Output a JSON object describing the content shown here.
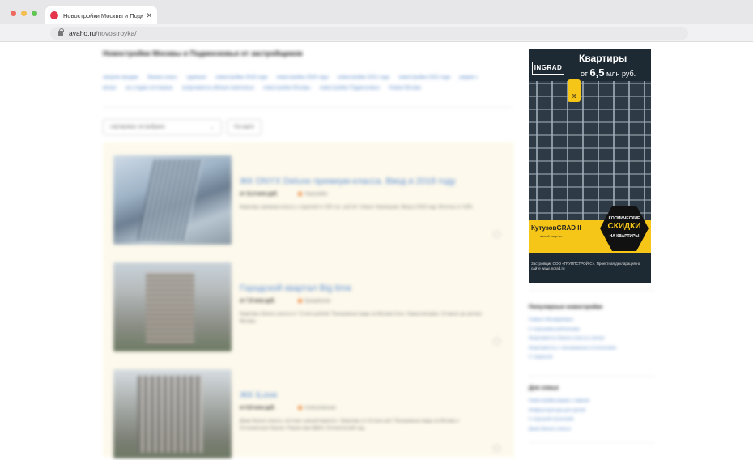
{
  "browser": {
    "tab_title": "Новостройки Москвы и Подм",
    "tab_close": "✕",
    "url_host": "avaho.ru",
    "url_path": "/novostroyka/"
  },
  "page": {
    "title": "Новостройки Москвы и Подмосковья от застройщиков",
    "tags": [
      "запуски продаж",
      "бизнес-класс",
      "сданные",
      "новостройки 2018 года",
      "новостройки 2020 года",
      "новостройки 2021 года",
      "новостройки 2022 года",
      "рядом с метро",
      "на стадии котлована",
      "апартаменты вблизи комплекса",
      "новостройки Москвы",
      "новостройки Подмосковья",
      "Новая Москва"
    ],
    "sort_label": "сортировка: не выбрано",
    "sort_chevron": "⌄",
    "map_button": "На карте"
  },
  "listings": [
    {
      "title": "ЖК ONYX Deluxe премиум-класса. Ввод в 2018 году",
      "price": "от 11,4 млн руб.",
      "metro": "Хорошёво",
      "desc": "Квартиры премиум-класса с отделкой от 230 тыс. руб./м². Новые Черемушки. Ввод в 2018 году. Ипотека от 4,8%."
    },
    {
      "title": "Городской квартал Big time",
      "price": "от 7,9 млн руб.",
      "metro": "Кунцевская",
      "desc": "Квартиры бизнес-класса от 7,9 млн рублей. Панорамные виды на Москва-Сити. Закрытый двор. 10 минут до центра Москвы."
    },
    {
      "title": "ЖК ILove",
      "price": "от 6,9 млн руб.",
      "metro": "Алексеевская",
      "desc": "Дома бизнес-класса, система «умный квартал». Квартиры от 6,9 млн руб. Панорамные виды на Москву и Останкинскую башню. Рядом парк ВДНХ, Ботанический сад."
    }
  ],
  "ad": {
    "logo": "INGRAD",
    "headline": "Квартиры",
    "price_prefix": "от",
    "price_value": "6,5",
    "price_suffix": "млн руб.",
    "hex_badge": "%",
    "project": "КутузовGRAD II",
    "project_sub": "жилой квартал",
    "sale_1": "КОСМИЧЕСКИЕ",
    "sale_2": "СКИДКИ",
    "sale_3": "НА КВАРТИРЫ",
    "footer": "Застройщик ООО «ГРУППСТРОЙ-С». Проектная декларация на сайте www.ingrad.ru",
    "colors": {
      "accent": "#f5c518",
      "dark": "#1d2a34"
    }
  },
  "sidebar": {
    "popular_title": "Популярные новостройки",
    "popular_links": [
      "Самые обсуждаемые",
      "С хорошими рейтингами",
      "Апартаменты бизнес-класса у метро",
      "Апартаменты с панорамным остеклением",
      "С террасой"
    ],
    "family_title": "Для семьи",
    "family_links": [
      "Новостройки рядом с парком",
      "Инфраструктура для детей",
      "С хорошей экологией",
      "Дома бизнес-класса"
    ]
  },
  "colors": {
    "link": "#4a7fc4",
    "listing_bg": "#fdf9ec",
    "title_link": "#5c8fd6"
  }
}
